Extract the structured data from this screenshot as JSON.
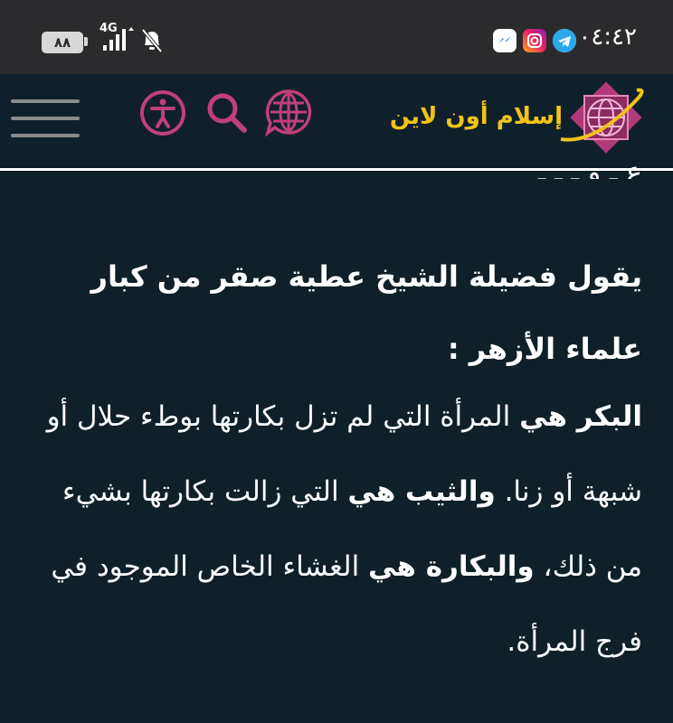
{
  "status_bar": {
    "time": "٠٤:٤٢",
    "battery": "٨٨",
    "network": "4G",
    "app_icons": [
      "messenger-icon",
      "instagram-icon",
      "telegram-icon"
    ]
  },
  "header": {
    "logo_text": "إسلام أون لاين",
    "icons": [
      "hamburger-menu-icon",
      "accessibility-icon",
      "search-icon",
      "language-globe-icon"
    ],
    "colors": {
      "accent": "#c0407a",
      "logo_gold": "#f2c21a",
      "background": "#0f202a"
    }
  },
  "article": {
    "heading": "يقول فضيلة الشيخ عطية صقر من كبار علماء الأزهر :",
    "p1_term": "البكر هي",
    "p1_text": " المرأة التي لم تزل بكارتها بوطء حلال أو شبهة أو زنا. ",
    "p2_term": "والثيب هي",
    "p2_text": " التي زالت بكارتها بشيء من ذلك، ",
    "p3_term": "والبكارة هي",
    "p3_text": " الغشاء الخاص الموجود في فرج المرأة."
  }
}
